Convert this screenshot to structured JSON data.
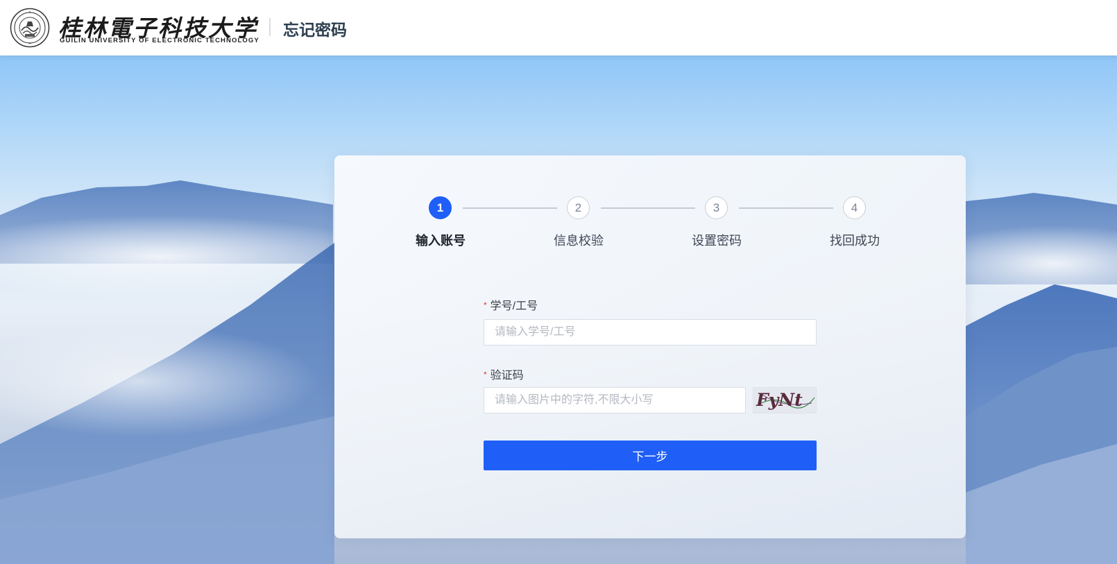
{
  "header": {
    "university_name_cn": "桂林電子科技大学",
    "university_name_en": "GUILIN UNIVERSITY OF ELECTRONIC TECHNOLOGY",
    "page_title": "忘记密码"
  },
  "steps": [
    {
      "number": "1",
      "label": "输入账号",
      "active": true
    },
    {
      "number": "2",
      "label": "信息校验",
      "active": false
    },
    {
      "number": "3",
      "label": "设置密码",
      "active": false
    },
    {
      "number": "4",
      "label": "找回成功",
      "active": false
    }
  ],
  "form": {
    "account": {
      "required_mark": "*",
      "label": "学号/工号",
      "value": "",
      "placeholder": "请输入学号/工号"
    },
    "captcha": {
      "required_mark": "*",
      "label": "验证码",
      "value": "",
      "placeholder": "请输入图片中的字符,不限大小写",
      "image_text": "FyNt"
    },
    "next_label": "下一步"
  },
  "colors": {
    "primary": "#1f5ef7",
    "required": "#e3352b",
    "header_title": "#2c3e50"
  }
}
